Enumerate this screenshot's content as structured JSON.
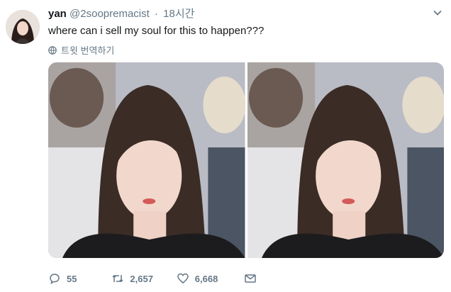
{
  "tweet": {
    "display_name": "yan",
    "handle": "@2soopremacist",
    "separator": "·",
    "timestamp": "18시간",
    "text": "where can i sell my soul for this to happen???",
    "translate_label": "트윗 번역하기",
    "media": [
      {
        "icon": "photo"
      },
      {
        "icon": "photo"
      }
    ]
  },
  "actions": {
    "reply_count": "55",
    "retweet_count": "2,657",
    "like_count": "6,668"
  },
  "colors": {
    "text_primary": "#14171a",
    "text_secondary": "#657786",
    "background": "#ffffff"
  }
}
